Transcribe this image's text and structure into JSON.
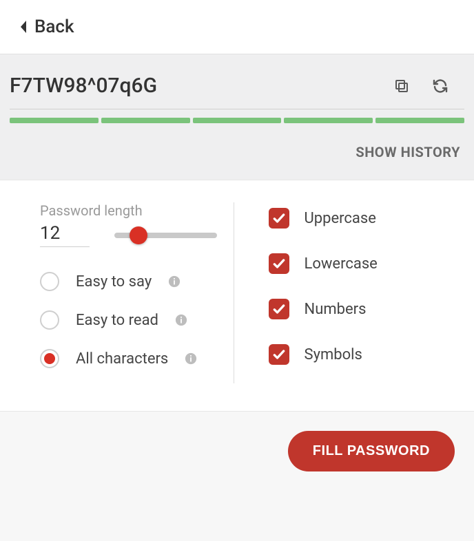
{
  "header": {
    "back_label": "Back"
  },
  "password": {
    "value": "F7TW98^07q6G",
    "strength_segments": 5,
    "strength_color": "#7bc37b",
    "show_history_label": "SHOW HISTORY"
  },
  "length": {
    "label": "Password length",
    "value": "12"
  },
  "mode_options": [
    {
      "label": "Easy to say",
      "selected": false
    },
    {
      "label": "Easy to read",
      "selected": false
    },
    {
      "label": "All characters",
      "selected": true
    }
  ],
  "char_options": [
    {
      "label": "Uppercase",
      "checked": true
    },
    {
      "label": "Lowercase",
      "checked": true
    },
    {
      "label": "Numbers",
      "checked": true
    },
    {
      "label": "Symbols",
      "checked": true
    }
  ],
  "footer": {
    "fill_label": "FILL PASSWORD"
  },
  "colors": {
    "accent": "#c0362c",
    "slider_thumb": "#d93025"
  }
}
